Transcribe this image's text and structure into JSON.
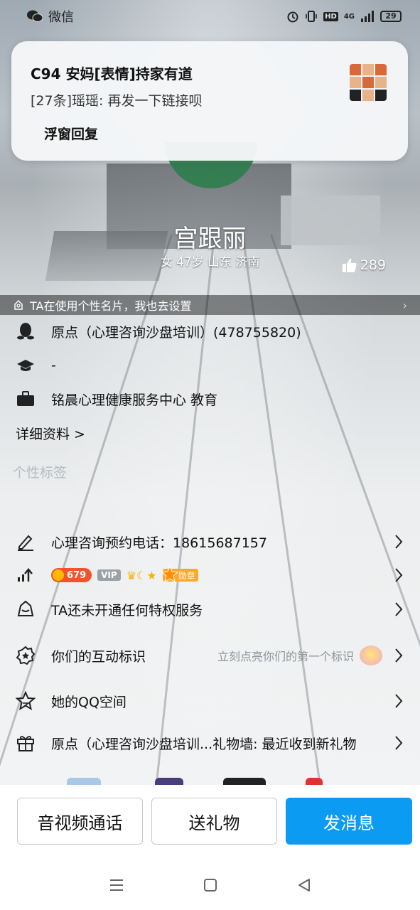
{
  "status_bar": {
    "carrier": "微信",
    "network": "4G",
    "battery": "29"
  },
  "notification": {
    "title": "C94 安妈[表情]持家有道",
    "message": "[27条]瑶瑶: 再发一下链接呗",
    "reply_label": "浮窗回复"
  },
  "profile": {
    "name": "宫跟丽",
    "subtitle": "女 47岁 山东 济南",
    "likes": "289",
    "card_banner": "TA在使用个性名片，我也去设置"
  },
  "info": {
    "qq_group": "原点（心理咨询沙盘培训）(478755820)",
    "school": "-",
    "company": "铭晨心理健康服务中心 教育",
    "detail_link": "详细资料 >"
  },
  "tags_title": "个性标签",
  "list": {
    "signature": "心理咨询预约电话：18615687157",
    "level": {
      "coin": "679",
      "vip": "VIP",
      "medal": "勋章"
    },
    "privilege": "TA还未开通任何特权服务",
    "interaction": "你们的互动标识",
    "interaction_hint": "立刻点亮你们的第一个标识",
    "qzone": "她的QQ空间",
    "gift_wall": "原点（心理咨询沙盘培训...礼物墙: 最近收到新礼物"
  },
  "actions": {
    "call": "音视频通话",
    "gift": "送礼物",
    "message": "发消息"
  },
  "colors": {
    "primary_button": "#0b9bf3",
    "coin": "#f0542c",
    "medal": "#ffa726"
  }
}
